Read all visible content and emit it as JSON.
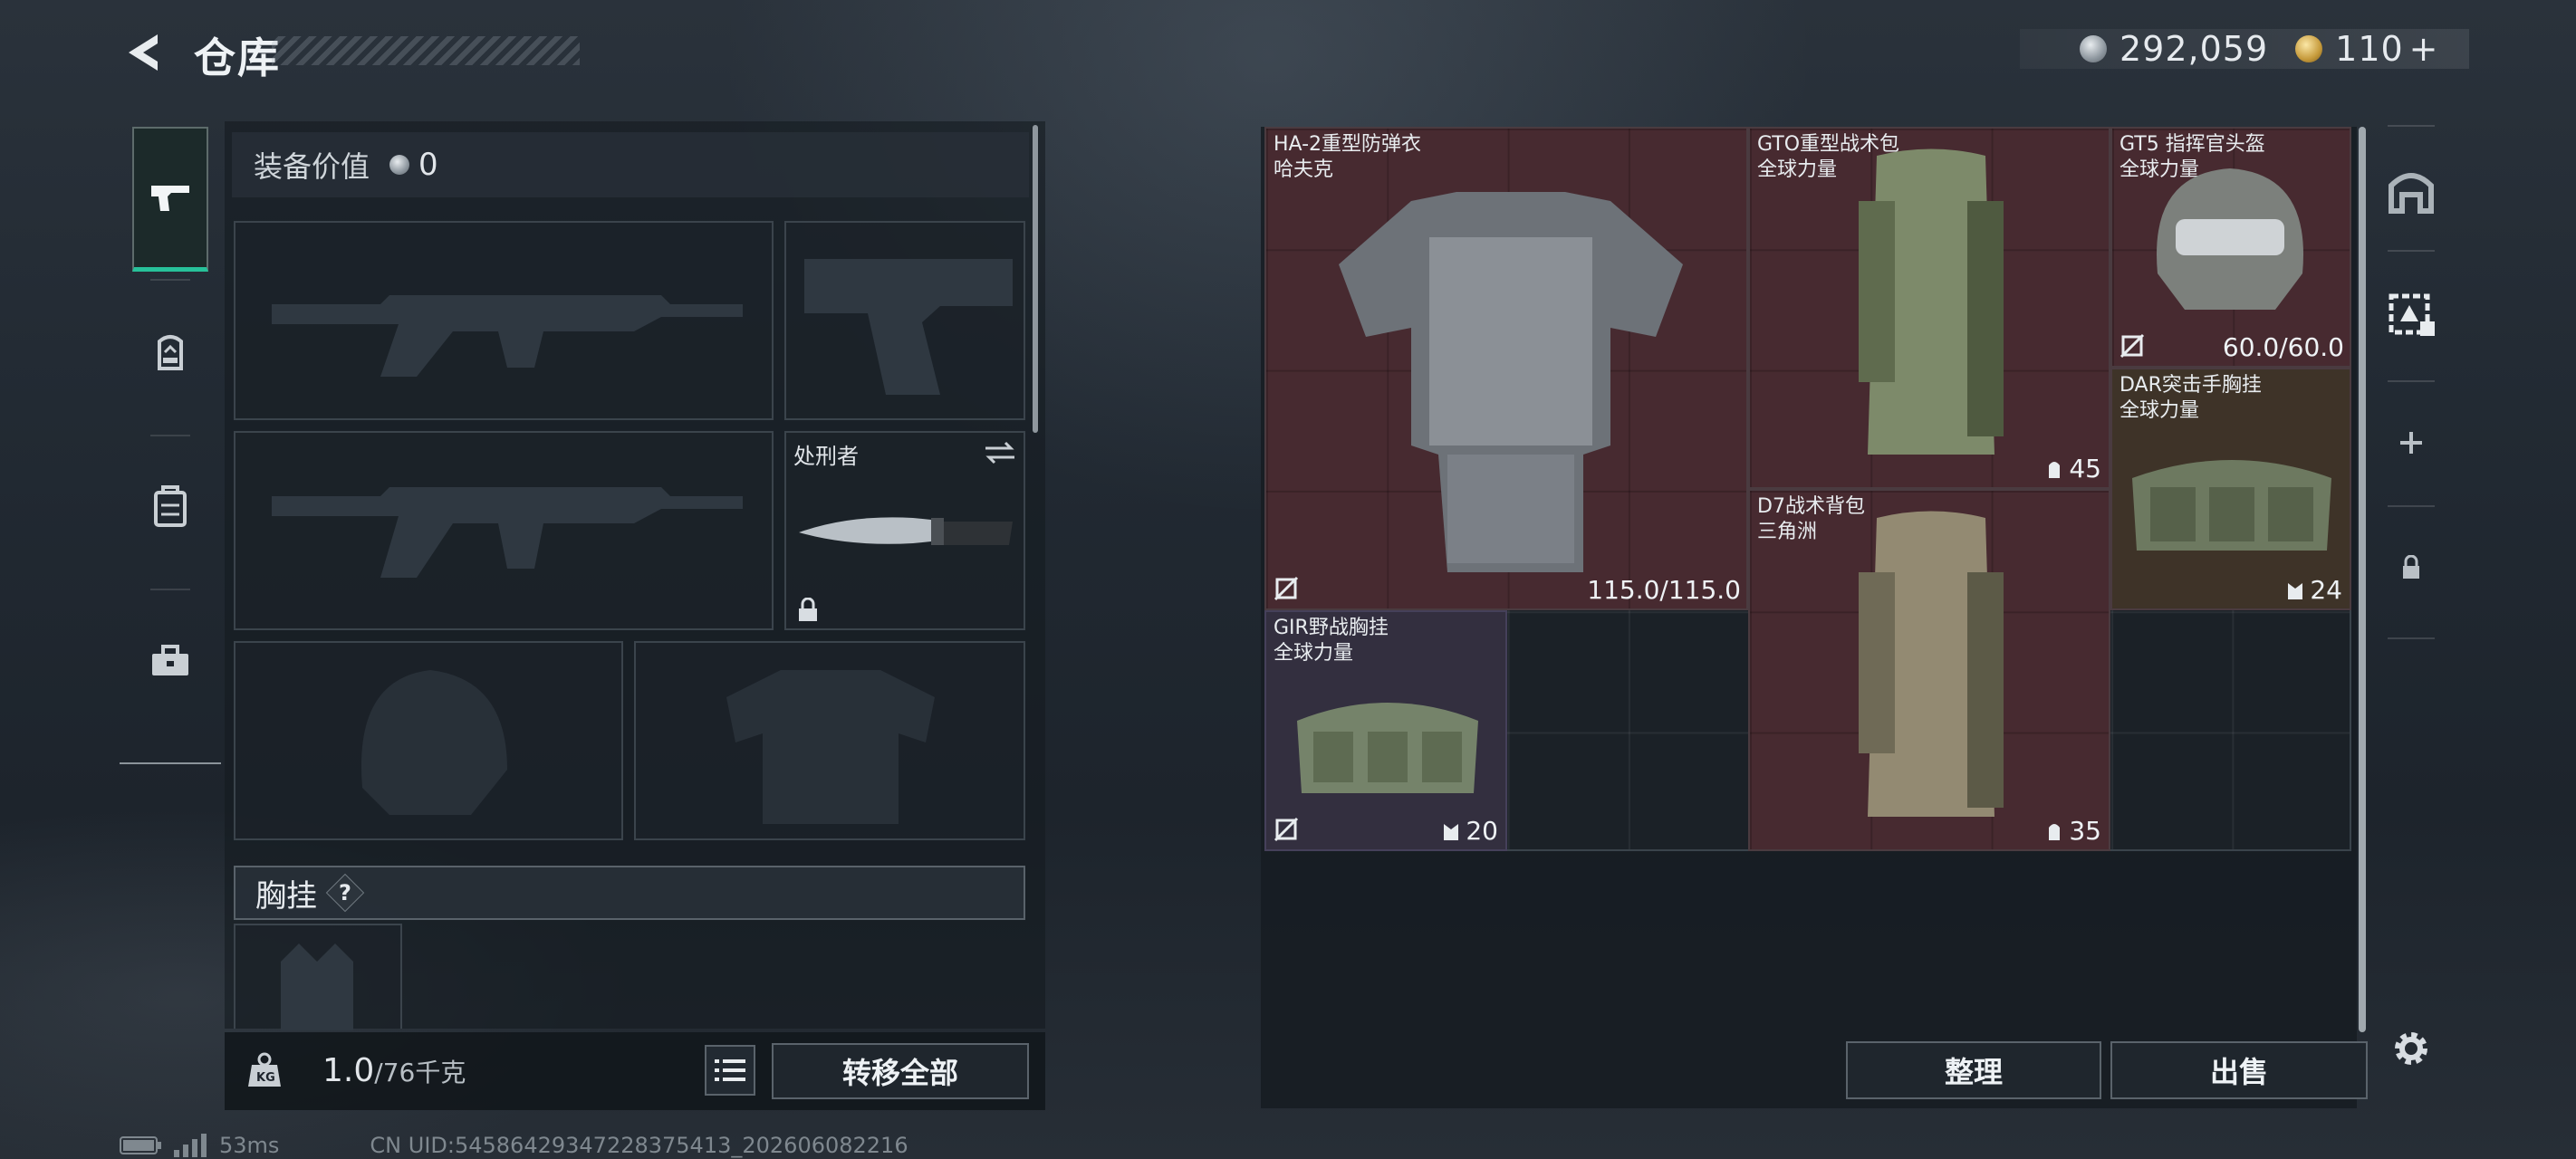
{
  "header": {
    "title": "仓库"
  },
  "currency": {
    "coins": "292,059",
    "tickets": "110",
    "tickets_plus": "+"
  },
  "equipment": {
    "value_label": "装备价值",
    "value": "0",
    "melee_name": "处刑者",
    "chest_label": "胸挂",
    "help": "?"
  },
  "footer_left": {
    "weight": "1.0",
    "weight_max": "/76千克",
    "transfer_all": "转移全部"
  },
  "storage": {
    "items": [
      {
        "name": "HA-2重型防弹衣\n哈夫克",
        "durability": "115.0/115.0"
      },
      {
        "name": "GTO重型战术包\n全球力量",
        "capacity": "45"
      },
      {
        "name": "GT5 指挥官头盔\n全球力量",
        "durability": "60.0/60.0"
      },
      {
        "name": "DAR突击手胸挂\n全球力量",
        "capacity": "24"
      },
      {
        "name": "D7战术背包\n三角洲",
        "capacity": "35"
      },
      {
        "name": "GIR野战胸挂\n全球力量",
        "capacity": "20"
      }
    ],
    "sort_label": "整理",
    "sell_label": "出售"
  },
  "status_bar": {
    "ping": "53ms",
    "uid": "CN UID:54586429347228375413_202606082216"
  },
  "colors": {
    "accent": "#27c19a",
    "item_red": "#472a30",
    "item_brown": "#3e3328",
    "item_purple": "#332f3f"
  }
}
